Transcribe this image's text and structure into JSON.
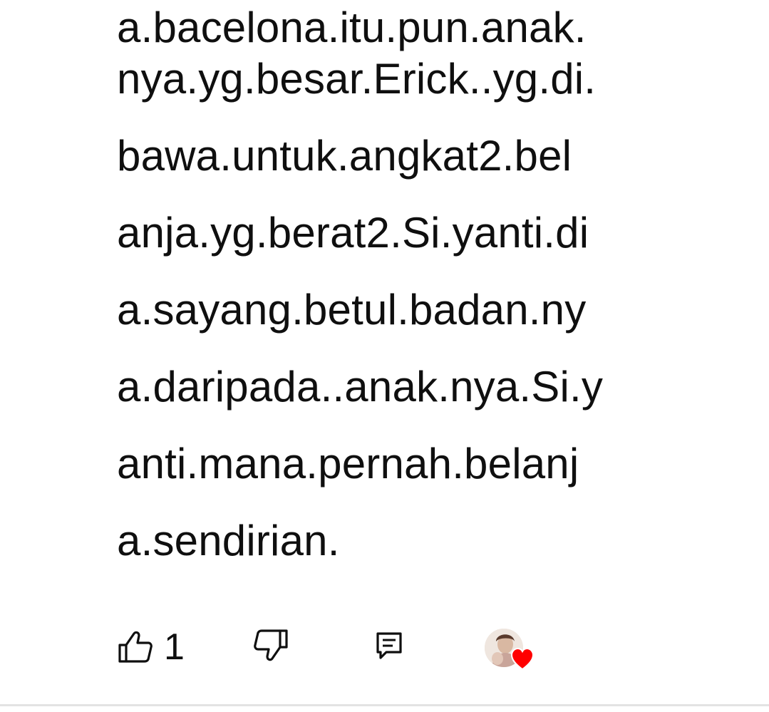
{
  "comment": {
    "lines": [
      "a.bacelona.itu.pun.anak.",
      "nya.yg.besar.Erick..yg.di.",
      "bawa.untuk.angkat2.bel",
      "anja.yg.berat2.Si.yanti.di",
      "a.sayang.betul.badan.ny",
      "a.daripada..anak.nya.Si.y",
      "anti.mana.pernah.belanj",
      "a.sendirian."
    ]
  },
  "actions": {
    "like_icon": "thumb-up-icon",
    "like_count": "1",
    "dislike_icon": "thumb-down-icon",
    "reply_icon": "comment-reply-icon",
    "creator_heart_icon": "heart-icon",
    "heart_color": "#ff0000"
  }
}
